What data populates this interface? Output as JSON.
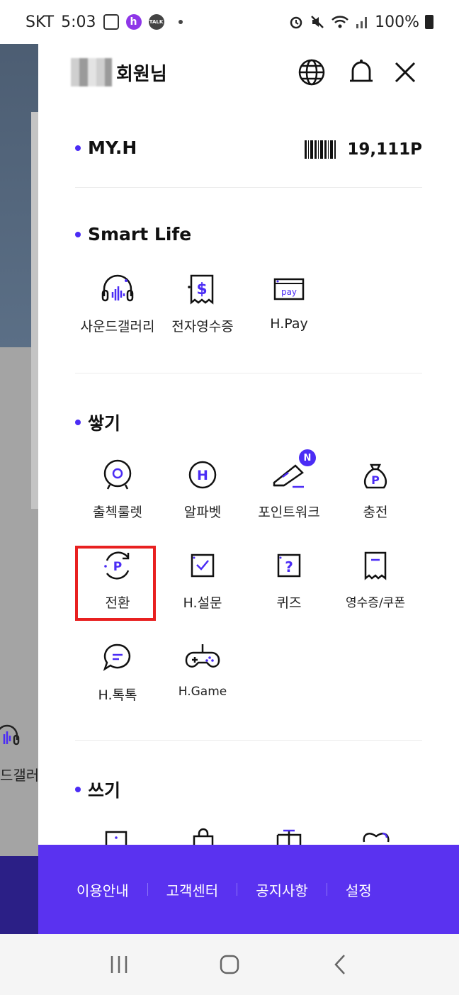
{
  "status_bar": {
    "carrier": "SKT",
    "time": "5:03",
    "hpoint_icon_text": "h",
    "talk_icon_text": "TALK",
    "battery": "100%",
    "icons": [
      "gallery-icon",
      "hpoint-app-icon",
      "kakaotalk-icon",
      "alarm-icon",
      "mute-icon",
      "wifi-icon",
      "signal-icon",
      "battery-icon"
    ]
  },
  "background_app": {
    "label": "드갤러리",
    "icon": "headphone-icon"
  },
  "header": {
    "member_label": "회원님",
    "icons": [
      "globe-icon",
      "bell-icon",
      "close-icon"
    ]
  },
  "my": {
    "title": "MY.H",
    "points": "19,111P",
    "barcode_icon": "barcode-icon"
  },
  "smart_life": {
    "title": "Smart Life",
    "items": [
      {
        "label": "사운드갤러리",
        "icon": "sound-gallery-icon"
      },
      {
        "label": "전자영수증",
        "icon": "e-receipt-icon"
      },
      {
        "label": "H.Pay",
        "icon": "hpay-icon"
      }
    ]
  },
  "earn": {
    "title": "쌓기",
    "items": [
      {
        "label": "출첵룰렛",
        "icon": "roulette-icon"
      },
      {
        "label": "알파벳",
        "icon": "alphabet-icon"
      },
      {
        "label": "포인트워크",
        "icon": "sneaker-icon",
        "badge": "N"
      },
      {
        "label": "충전",
        "icon": "money-bag-icon"
      },
      {
        "label": "전환",
        "icon": "point-convert-icon",
        "highlighted": true
      },
      {
        "label": "H.설문",
        "icon": "survey-icon"
      },
      {
        "label": "퀴즈",
        "icon": "quiz-icon"
      },
      {
        "label": "영수증/쿠폰",
        "icon": "receipt-coupon-icon"
      },
      {
        "label": "H.톡톡",
        "icon": "chat-icon"
      },
      {
        "label": "H.Game",
        "icon": "gamepad-icon"
      }
    ]
  },
  "spend": {
    "title": "쓰기",
    "icons": [
      "store-icon",
      "shopping-bag-icon",
      "gift-icon",
      "donation-icon"
    ]
  },
  "footer": {
    "links": [
      "이용안내",
      "고객센터",
      "공지사항",
      "설정"
    ]
  },
  "colors": {
    "accent": "#5a32f0",
    "bullet": "#4b2cf5",
    "highlight_border": "#e82020"
  }
}
